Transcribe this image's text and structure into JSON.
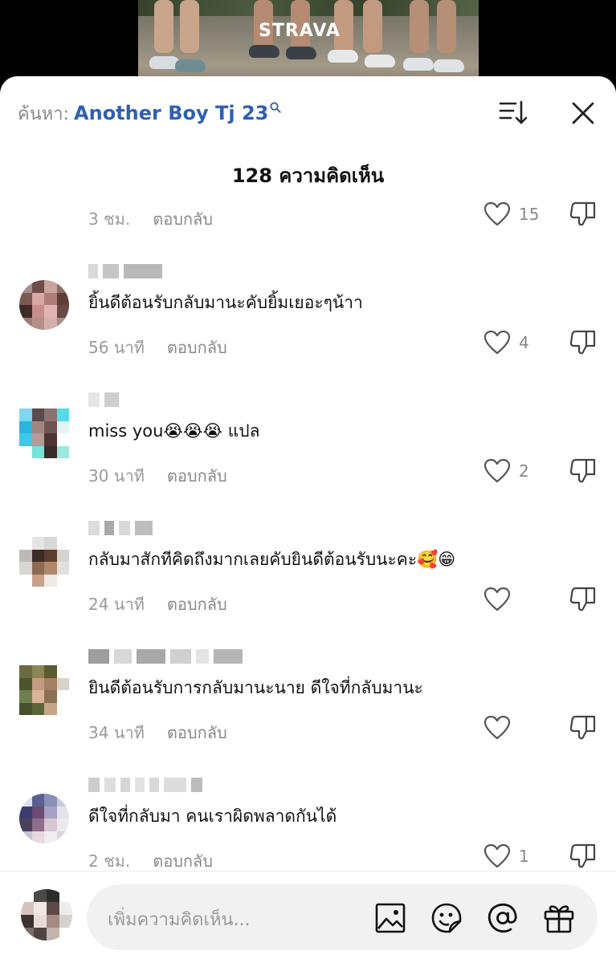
{
  "video": {
    "brand_watermark": "STRAVA"
  },
  "search": {
    "prefix": "ค้นหา:",
    "query": "Another Boy Tj 23",
    "query_icon": "search-icon"
  },
  "toolbar": {
    "sort_icon": "sort-icon",
    "close_icon": "close-icon"
  },
  "comments_count": "128 ความคิดเห็น",
  "partial_comment": {
    "time": "3 ชม.",
    "reply": "ตอบกลับ",
    "likes": "15"
  },
  "comments": [
    {
      "text": "ยิ้นดีต้อนรับกลับมานะคับยิ้มเยอะๆน้าา",
      "time": "56 นาที",
      "reply": "ตอบกลับ",
      "likes": "4"
    },
    {
      "text": "miss you😭😭😭 แปล",
      "time": "30 นาที",
      "reply": "ตอบกลับ",
      "likes": "2"
    },
    {
      "text": "กลับมาสักทีคิดถึงมากเลยคับยินดีต้อนรับนะคะ🥰😁",
      "time": "24 นาที",
      "reply": "ตอบกลับ",
      "likes": ""
    },
    {
      "text": "ยินดีต้อนรับการกลับมานะนาย ดีใจที่กลับมานะ",
      "time": "34 นาที",
      "reply": "ตอบกลับ",
      "likes": ""
    },
    {
      "text": "ดีใจที่กลับมา คนเราผิดพลาดกันได้",
      "time": "2 ชม.",
      "reply": "ตอบกลับ",
      "likes": "1"
    }
  ],
  "input": {
    "placeholder": "เพิ่มความคิดเห็น...",
    "icons": [
      "image-icon",
      "emoji-icon",
      "mention-icon",
      "gift-icon"
    ]
  },
  "colors": {
    "accent": "#2f5faf",
    "muted": "#9a9a9a",
    "input_bg": "#f1f1f2"
  }
}
